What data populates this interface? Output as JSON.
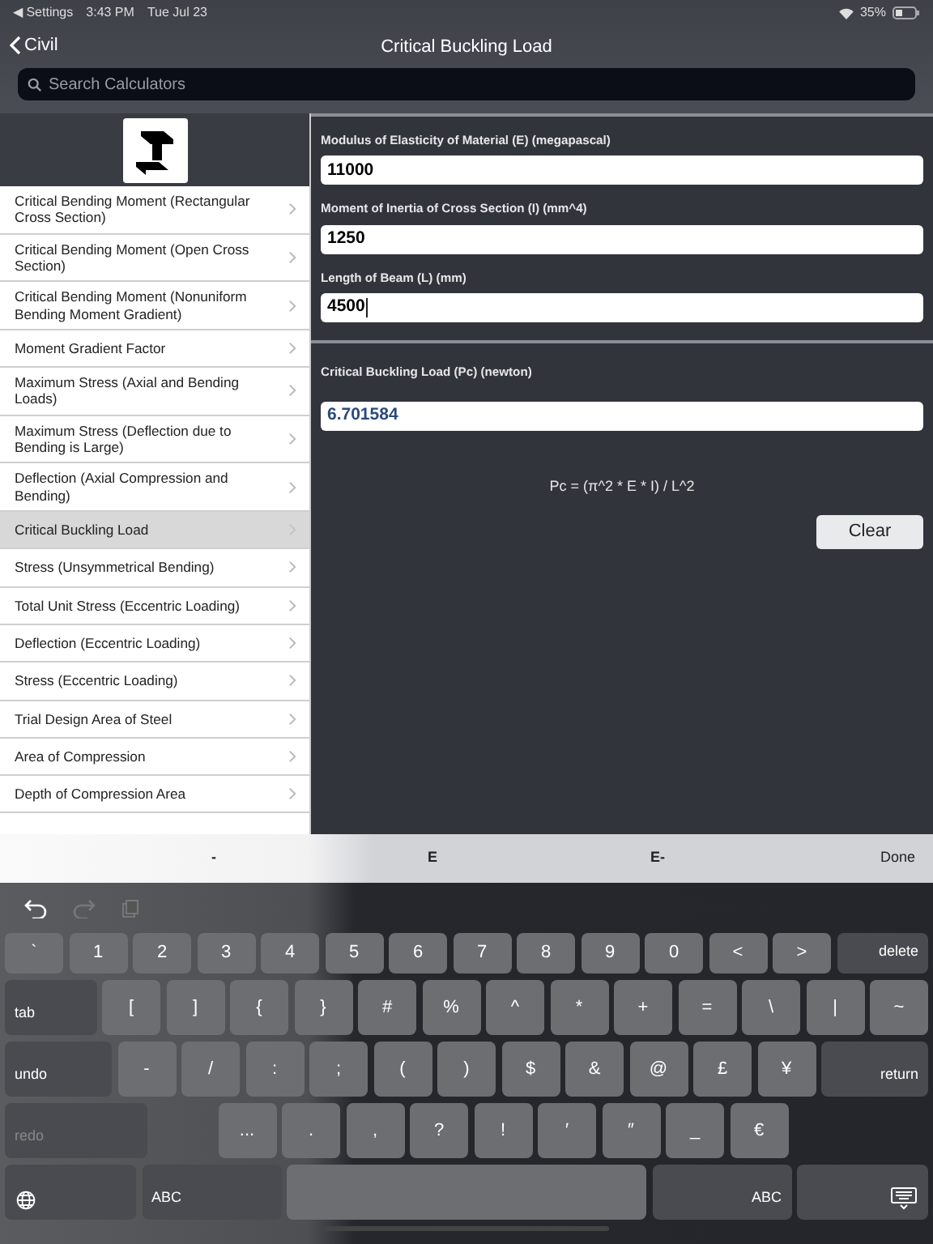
{
  "status_bar": {
    "back_app": "◀ Settings",
    "time": "3:43 PM",
    "date": "Tue Jul 23",
    "battery": "35%"
  },
  "nav": {
    "back": "Civil",
    "title": "Critical Buckling Load"
  },
  "search": {
    "placeholder": "Search Calculators"
  },
  "sidebar": {
    "items": [
      {
        "label": "Critical Bending Moment (Rectangular Cross Section)",
        "selected": false
      },
      {
        "label": "Critical Bending Moment (Open Cross Section)",
        "selected": false
      },
      {
        "label": "Critical Bending Moment (Nonuniform Bending Moment Gradient)",
        "selected": false
      },
      {
        "label": "Moment Gradient Factor",
        "selected": false
      },
      {
        "label": "Maximum Stress (Axial and Bending Loads)",
        "selected": false
      },
      {
        "label": "Maximum Stress (Deflection due to Bending is Large)",
        "selected": false
      },
      {
        "label": "Deflection (Axial Compression and Bending)",
        "selected": false
      },
      {
        "label": "Critical Buckling Load",
        "selected": true
      },
      {
        "label": "Stress (Unsymmetrical Bending)",
        "selected": false
      },
      {
        "label": "Total Unit Stress (Eccentric Loading)",
        "selected": false
      },
      {
        "label": "Deflection (Eccentric Loading)",
        "selected": false
      },
      {
        "label": "Stress (Eccentric Loading)",
        "selected": false
      },
      {
        "label": "Trial Design Area of Steel",
        "selected": false
      },
      {
        "label": "Area of Compression",
        "selected": false
      },
      {
        "label": "Depth of Compression Area",
        "selected": false
      }
    ]
  },
  "inputs": [
    {
      "label": "Modulus of Elasticity of Material (E) (megapascal)",
      "value": "11000",
      "focused": false
    },
    {
      "label": "Moment of Inertia of Cross Section (I) (mm^4)",
      "value": "1250",
      "focused": false
    },
    {
      "label": "Length of Beam (L) (mm)",
      "value": "4500",
      "focused": true
    }
  ],
  "result": {
    "label": "Critical Buckling Load (Pc) (newton)",
    "value": "6.701584"
  },
  "formula": "Pc = (π^2 * E * I) / L^2",
  "clear_button": "Clear",
  "accessory_bar": [
    "-",
    "E",
    "E-",
    "Done"
  ],
  "keyboard": {
    "rows": [
      {
        "keys": [
          {
            "label": "`",
            "kind": "char"
          },
          {
            "label": "1",
            "kind": "char"
          },
          {
            "label": "2",
            "kind": "char"
          },
          {
            "label": "3",
            "kind": "char"
          },
          {
            "label": "4",
            "kind": "char"
          },
          {
            "label": "5",
            "kind": "char"
          },
          {
            "label": "6",
            "kind": "char"
          },
          {
            "label": "7",
            "kind": "char"
          },
          {
            "label": "8",
            "kind": "char"
          },
          {
            "label": "9",
            "kind": "char"
          },
          {
            "label": "0",
            "kind": "char"
          },
          {
            "label": "<",
            "kind": "char"
          },
          {
            "label": ">",
            "kind": "char"
          },
          {
            "label": "delete",
            "kind": "action"
          }
        ]
      },
      {
        "keys": [
          {
            "label": "tab",
            "kind": "action"
          },
          {
            "label": "[",
            "kind": "char"
          },
          {
            "label": "]",
            "kind": "char"
          },
          {
            "label": "{",
            "kind": "char"
          },
          {
            "label": "}",
            "kind": "char"
          },
          {
            "label": "#",
            "kind": "char"
          },
          {
            "label": "%",
            "kind": "char"
          },
          {
            "label": "^",
            "kind": "char"
          },
          {
            "label": "*",
            "kind": "char"
          },
          {
            "label": "+",
            "kind": "char"
          },
          {
            "label": "=",
            "kind": "char"
          },
          {
            "label": "\\",
            "kind": "char"
          },
          {
            "label": "|",
            "kind": "char"
          },
          {
            "label": "~",
            "kind": "char"
          }
        ]
      },
      {
        "keys": [
          {
            "label": "undo",
            "kind": "action"
          },
          {
            "label": "-",
            "kind": "char"
          },
          {
            "label": "/",
            "kind": "char"
          },
          {
            "label": ":",
            "kind": "char"
          },
          {
            "label": ";",
            "kind": "char"
          },
          {
            "label": "(",
            "kind": "char"
          },
          {
            "label": ")",
            "kind": "char"
          },
          {
            "label": "$",
            "kind": "char"
          },
          {
            "label": "&",
            "kind": "char"
          },
          {
            "label": "@",
            "kind": "char"
          },
          {
            "label": "£",
            "kind": "char"
          },
          {
            "label": "¥",
            "kind": "char"
          },
          {
            "label": "return",
            "kind": "action"
          }
        ]
      },
      {
        "keys": [
          {
            "label": "redo",
            "kind": "disabled"
          },
          {
            "label": "...",
            "kind": "char"
          },
          {
            "label": ".",
            "kind": "char"
          },
          {
            "label": ",",
            "kind": "char"
          },
          {
            "label": "?",
            "kind": "char"
          },
          {
            "label": "!",
            "kind": "char"
          },
          {
            "label": "′",
            "kind": "char"
          },
          {
            "label": "″",
            "kind": "char"
          },
          {
            "label": "_",
            "kind": "char"
          },
          {
            "label": "€",
            "kind": "char"
          }
        ]
      },
      {
        "keys": [
          {
            "kind": "globe"
          },
          {
            "label": "ABC",
            "kind": "action"
          },
          {
            "kind": "space"
          },
          {
            "label": "ABC",
            "kind": "action"
          },
          {
            "kind": "dismiss"
          }
        ]
      }
    ]
  }
}
